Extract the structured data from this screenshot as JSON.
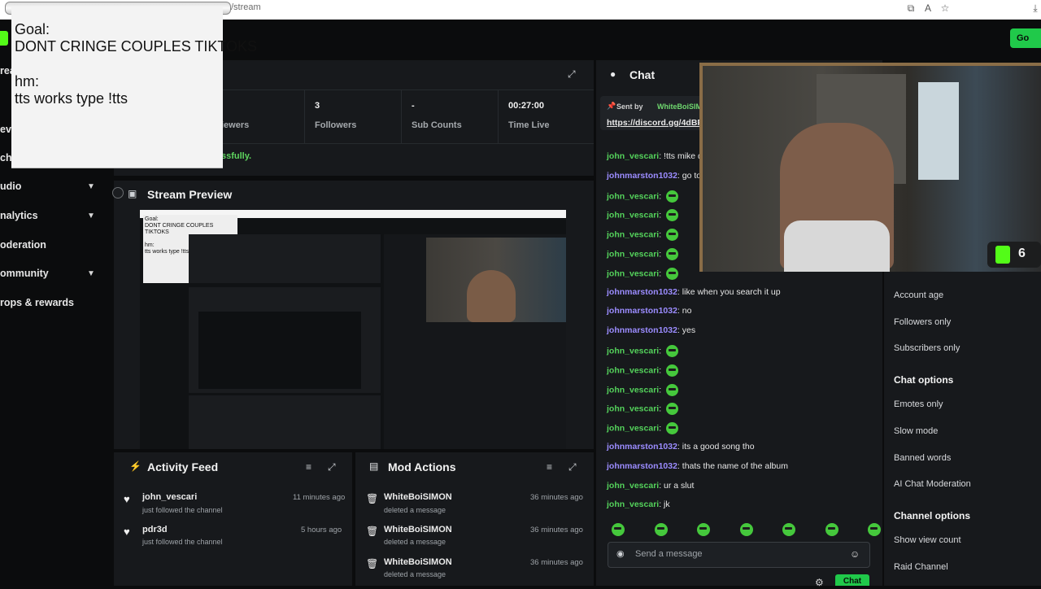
{
  "browser": {
    "url_path": "/stream"
  },
  "header": {
    "go_label": "Go"
  },
  "goal_overlay": {
    "line1": "Goal:",
    "line2": "DONT CRINGE COUPLES TIKTOKS",
    "line3": "hm:",
    "line4": "tts works type !tts"
  },
  "sidebar": {
    "items": [
      {
        "label": "rea"
      },
      {
        "label": "eve"
      },
      {
        "label": "chi"
      },
      {
        "label": "udio"
      },
      {
        "label": "nalytics"
      },
      {
        "label": "oderation"
      },
      {
        "label": "ommunity"
      },
      {
        "label": "rops & rewards"
      }
    ]
  },
  "stats": {
    "viewers_label": "iewers",
    "followers_value": "3",
    "followers_label": "Followers",
    "subs_value": "-",
    "subs_label": "Sub Counts",
    "time_value": "00:27:00",
    "time_label": "Time Live",
    "status_text": "ssfully."
  },
  "stream_preview": {
    "title": "Stream Preview"
  },
  "activity_feed": {
    "title": "Activity Feed",
    "items": [
      {
        "name": "john_vescari",
        "action": "just followed the channel",
        "time": "11 minutes ago"
      },
      {
        "name": "pdr3d",
        "action": "just followed the channel",
        "time": "5 hours ago"
      }
    ]
  },
  "mod_actions": {
    "title": "Mod Actions",
    "items": [
      {
        "name": "WhiteBoiSIMON",
        "action": "deleted a message",
        "time": "36 minutes ago"
      },
      {
        "name": "WhiteBoiSIMON",
        "action": "deleted a message",
        "time": "36 minutes ago"
      },
      {
        "name": "WhiteBoiSIMON",
        "action": "deleted a message",
        "time": "36 minutes ago"
      }
    ]
  },
  "chat": {
    "title": "Chat",
    "pinned_prefix": "Sent by",
    "pinned_user": "WhiteBoiSIM",
    "pinned_link": "https://discord.gg/4dBF",
    "messages": [
      {
        "user": "john_vescari",
        "color": "green",
        "text": "!tts mike d",
        "emotes": 0
      },
      {
        "user": "johnmarston1032",
        "color": "purple",
        "text": "go to",
        "emotes": 0
      },
      {
        "user": "john_vescari",
        "color": "green",
        "text": "",
        "emotes": 1
      },
      {
        "user": "john_vescari",
        "color": "green",
        "text": "",
        "emotes": 1
      },
      {
        "user": "john_vescari",
        "color": "green",
        "text": "",
        "emotes": 1
      },
      {
        "user": "john_vescari",
        "color": "green",
        "text": "",
        "emotes": 1
      },
      {
        "user": "john_vescari",
        "color": "green",
        "text": "",
        "emotes": 1
      },
      {
        "user": "johnmarston1032",
        "color": "purple",
        "text": "like when you search it up",
        "emotes": 0
      },
      {
        "user": "johnmarston1032",
        "color": "purple",
        "text": "no",
        "emotes": 0
      },
      {
        "user": "johnmarston1032",
        "color": "purple",
        "text": "yes",
        "emotes": 0
      },
      {
        "user": "john_vescari",
        "color": "green",
        "text": "",
        "emotes": 1
      },
      {
        "user": "john_vescari",
        "color": "green",
        "text": "",
        "emotes": 1
      },
      {
        "user": "john_vescari",
        "color": "green",
        "text": "",
        "emotes": 1
      },
      {
        "user": "john_vescari",
        "color": "green",
        "text": "",
        "emotes": 1
      },
      {
        "user": "john_vescari",
        "color": "green",
        "text": "",
        "emotes": 1
      },
      {
        "user": "johnmarston1032",
        "color": "purple",
        "text": "its a good song tho",
        "emotes": 0
      },
      {
        "user": "johnmarston1032",
        "color": "purple",
        "text": "thats the name of the album",
        "emotes": 0
      },
      {
        "user": "john_vescari",
        "color": "green",
        "text": "ur a slut",
        "emotes": 0
      },
      {
        "user": "john_vescari",
        "color": "green",
        "text": "jk",
        "emotes": 0
      }
    ],
    "input_placeholder": "Send a message",
    "send_label": "Chat"
  },
  "chat_settings": {
    "items_top": [
      "Account age",
      "Followers only",
      "Subscribers only"
    ],
    "chat_options_title": "Chat options",
    "chat_options": [
      "Emotes only",
      "Slow mode",
      "Banned words",
      "AI Chat Moderation"
    ],
    "channel_options_title": "Channel options",
    "channel_options": [
      "Show view count",
      "Raid Channel"
    ]
  },
  "webcam": {
    "viewer_count": "6"
  },
  "colors": {
    "accent": "#53fc18",
    "panel": "#17191c",
    "background": "#0b0c0d",
    "username_green": "#54d25b",
    "username_purple": "#9b8cff"
  }
}
